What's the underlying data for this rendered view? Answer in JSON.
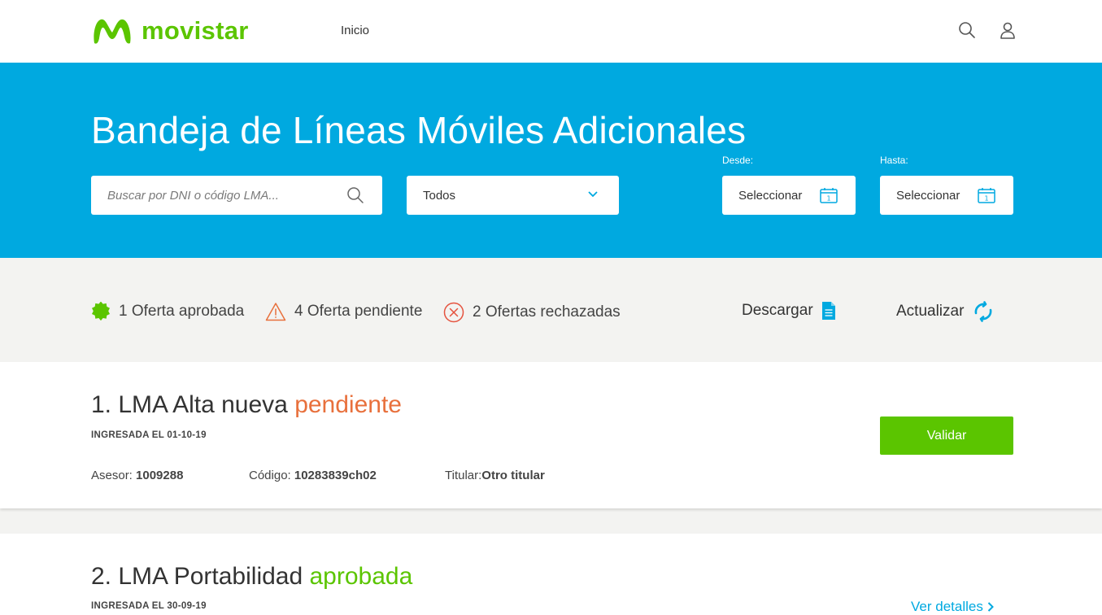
{
  "nav": {
    "brand": "movistar",
    "links": [
      "Inicio"
    ],
    "icons": [
      "search-icon",
      "user-icon"
    ]
  },
  "hero": {
    "title": "Bandeja de Líneas Móviles Adicionales",
    "search_placeholder": "Buscar por DNI o código LMA...",
    "filter_selected": "Todos",
    "from_label": "Desde:",
    "from_value": "Seleccionar",
    "to_label": "Hasta:",
    "to_value": "Seleccionar"
  },
  "summary": {
    "approved": "1 Oferta aprobada",
    "pending": "4 Oferta pendiente",
    "rejected": "2 Ofertas rechazadas",
    "download": "Descargar",
    "refresh": "Actualizar"
  },
  "records": [
    {
      "title": "1. LMA Alta nueva",
      "status": "pendiente",
      "date": "INGRESADA EL 01-10-19",
      "advisor_label": "Asesor:",
      "advisor": "1009288",
      "code_label": "Código:",
      "code": "10283839ch02",
      "holder_label": "Titular:",
      "holder": "Otro titular",
      "action": "Validar"
    },
    {
      "title": "2. LMA Portabilidad",
      "status": "aprobada",
      "date": "INGRESADA EL 30-09-19",
      "action": "Ver detalles"
    }
  ],
  "colors": {
    "brand_green": "#5bc500",
    "hero_blue": "#00a9e0",
    "pending_orange": "#e8703c",
    "rejected_red": "#e5533f"
  }
}
